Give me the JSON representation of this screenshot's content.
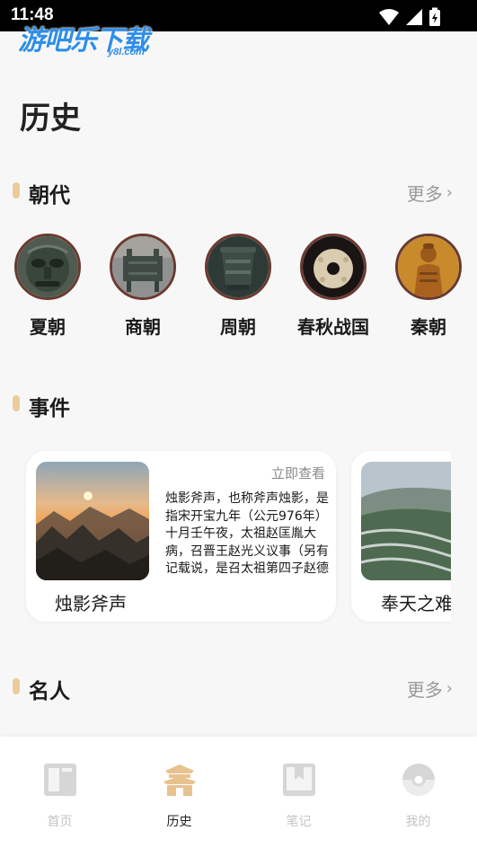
{
  "status_bar": {
    "time": "11:48"
  },
  "watermark": {
    "text": "游吧乐下载",
    "sub": "y8l.com"
  },
  "page": {
    "title": "历史"
  },
  "dynasty_section": {
    "title": "朝代",
    "more": "更多",
    "items": [
      {
        "label": "夏朝",
        "icon": "bronze-mask"
      },
      {
        "label": "商朝",
        "icon": "bronze-ding"
      },
      {
        "label": "周朝",
        "icon": "bronze-vessel"
      },
      {
        "label": "春秋战国",
        "icon": "jade-bi-disc"
      },
      {
        "label": "秦朝",
        "icon": "terracotta-warrior"
      }
    ]
  },
  "event_section": {
    "title": "事件",
    "cards": [
      {
        "title": "烛影斧声",
        "view_label": "立即查看",
        "description": "烛影斧声，也称斧声烛影，是指宋开宝九年（公元976年）十月壬午夜，太祖赵匡胤大病，召晋王赵光义议事（另有记载说，是召太祖第四子赵德芳进宫商议后事…"
      },
      {
        "title": "奉天之难",
        "view_label": "",
        "description": ""
      }
    ]
  },
  "people_section": {
    "title": "名人",
    "more": "更多"
  },
  "tabbar": {
    "tabs": [
      {
        "label": "首页",
        "icon": "home-book-icon"
      },
      {
        "label": "历史",
        "icon": "palace-icon"
      },
      {
        "label": "笔记",
        "icon": "bookmark-note-icon"
      },
      {
        "label": "我的",
        "icon": "profile-ball-icon"
      }
    ]
  },
  "colors": {
    "accent": "#ebcc9a",
    "active_tab_icon": "#e8c28e",
    "inactive": "#c4c4c4"
  }
}
